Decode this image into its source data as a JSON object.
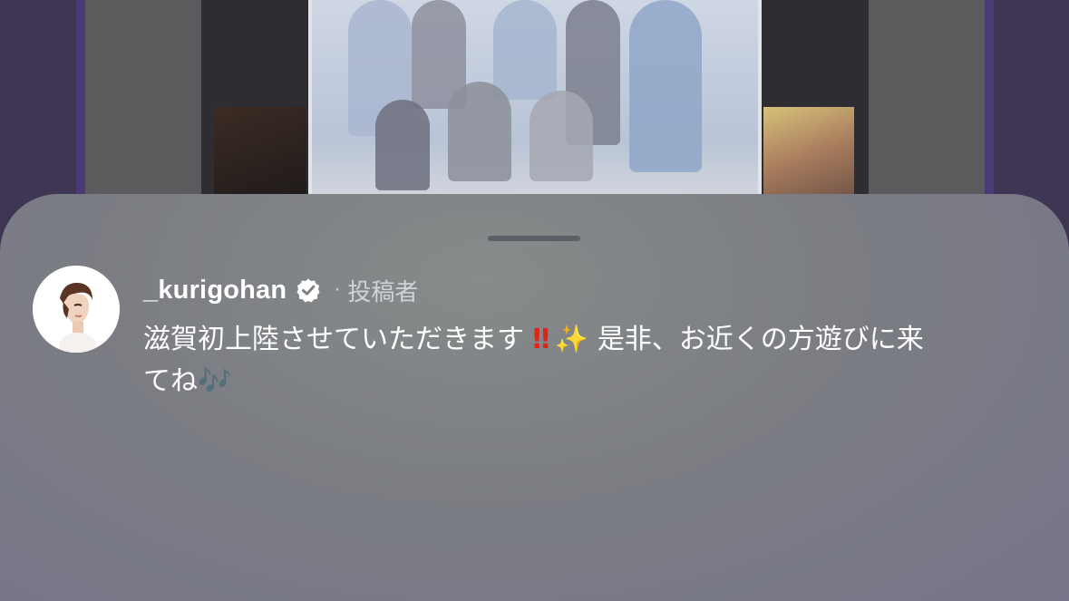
{
  "comment": {
    "username": "_kurigohan",
    "separator": "·",
    "role_label": "投稿者",
    "text_part1": "滋賀初上陸させていただきます",
    "emoji_bang": "‼",
    "emoji_sparkles": "✨",
    "text_part2": "是非、お近くの方遊びに来てね",
    "emoji_notes": "🎶"
  },
  "colors": {
    "sheet": "#7e8084",
    "username": "#ffffff",
    "role": "#d2d3d7",
    "verified_badge": "#ffffff",
    "bang": "#e2231a",
    "sparkles": "#f4c430"
  },
  "icons": {
    "verified": "verified-badge-icon",
    "avatar": "profile-avatar"
  }
}
